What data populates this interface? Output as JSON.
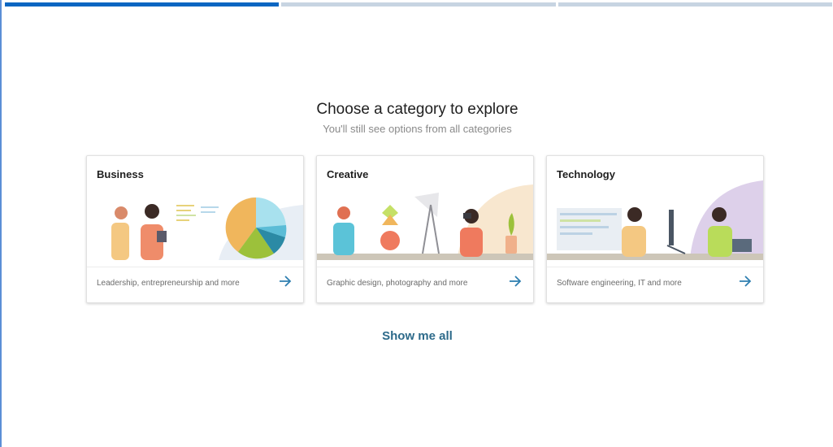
{
  "progress": {
    "total_steps": 3,
    "current_step": 1
  },
  "heading": "Choose a category to explore",
  "subheading": "You'll still see options from all categories",
  "cards": [
    {
      "title": "Business",
      "description": "Leadership, entrepreneurship and more"
    },
    {
      "title": "Creative",
      "description": "Graphic design, photography and more"
    },
    {
      "title": "Technology",
      "description": "Software engineering, IT and more"
    }
  ],
  "show_all_label": "Show me all",
  "colors": {
    "accent": "#0a66c2",
    "link": "#2d6a8a",
    "arrow": "#2f7fb0"
  },
  "icons": {
    "card_arrow": "arrow-right-icon"
  }
}
